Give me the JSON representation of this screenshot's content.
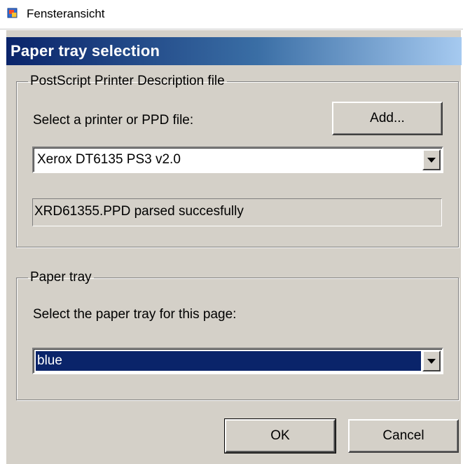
{
  "host": {
    "title": "Fensteransicht",
    "icon": "window-view-icon"
  },
  "dialog": {
    "title": "Paper tray selection",
    "ppd_group": {
      "legend": "PostScript Printer Description file",
      "select_label": "Select a printer or PPD file:",
      "add_button": "Add...",
      "printer_value": "Xerox DT6135 PS3 v2.0",
      "status": "XRD61355.PPD parsed succesfully"
    },
    "tray_group": {
      "legend": "Paper tray",
      "select_label": "Select the paper tray for this page:",
      "tray_value": "blue"
    },
    "ok_button": "OK",
    "cancel_button": "Cancel"
  },
  "colors": {
    "titlebar": "#0a246a",
    "dialog_face": "#d4d0c8",
    "selection": "#0a246a"
  }
}
